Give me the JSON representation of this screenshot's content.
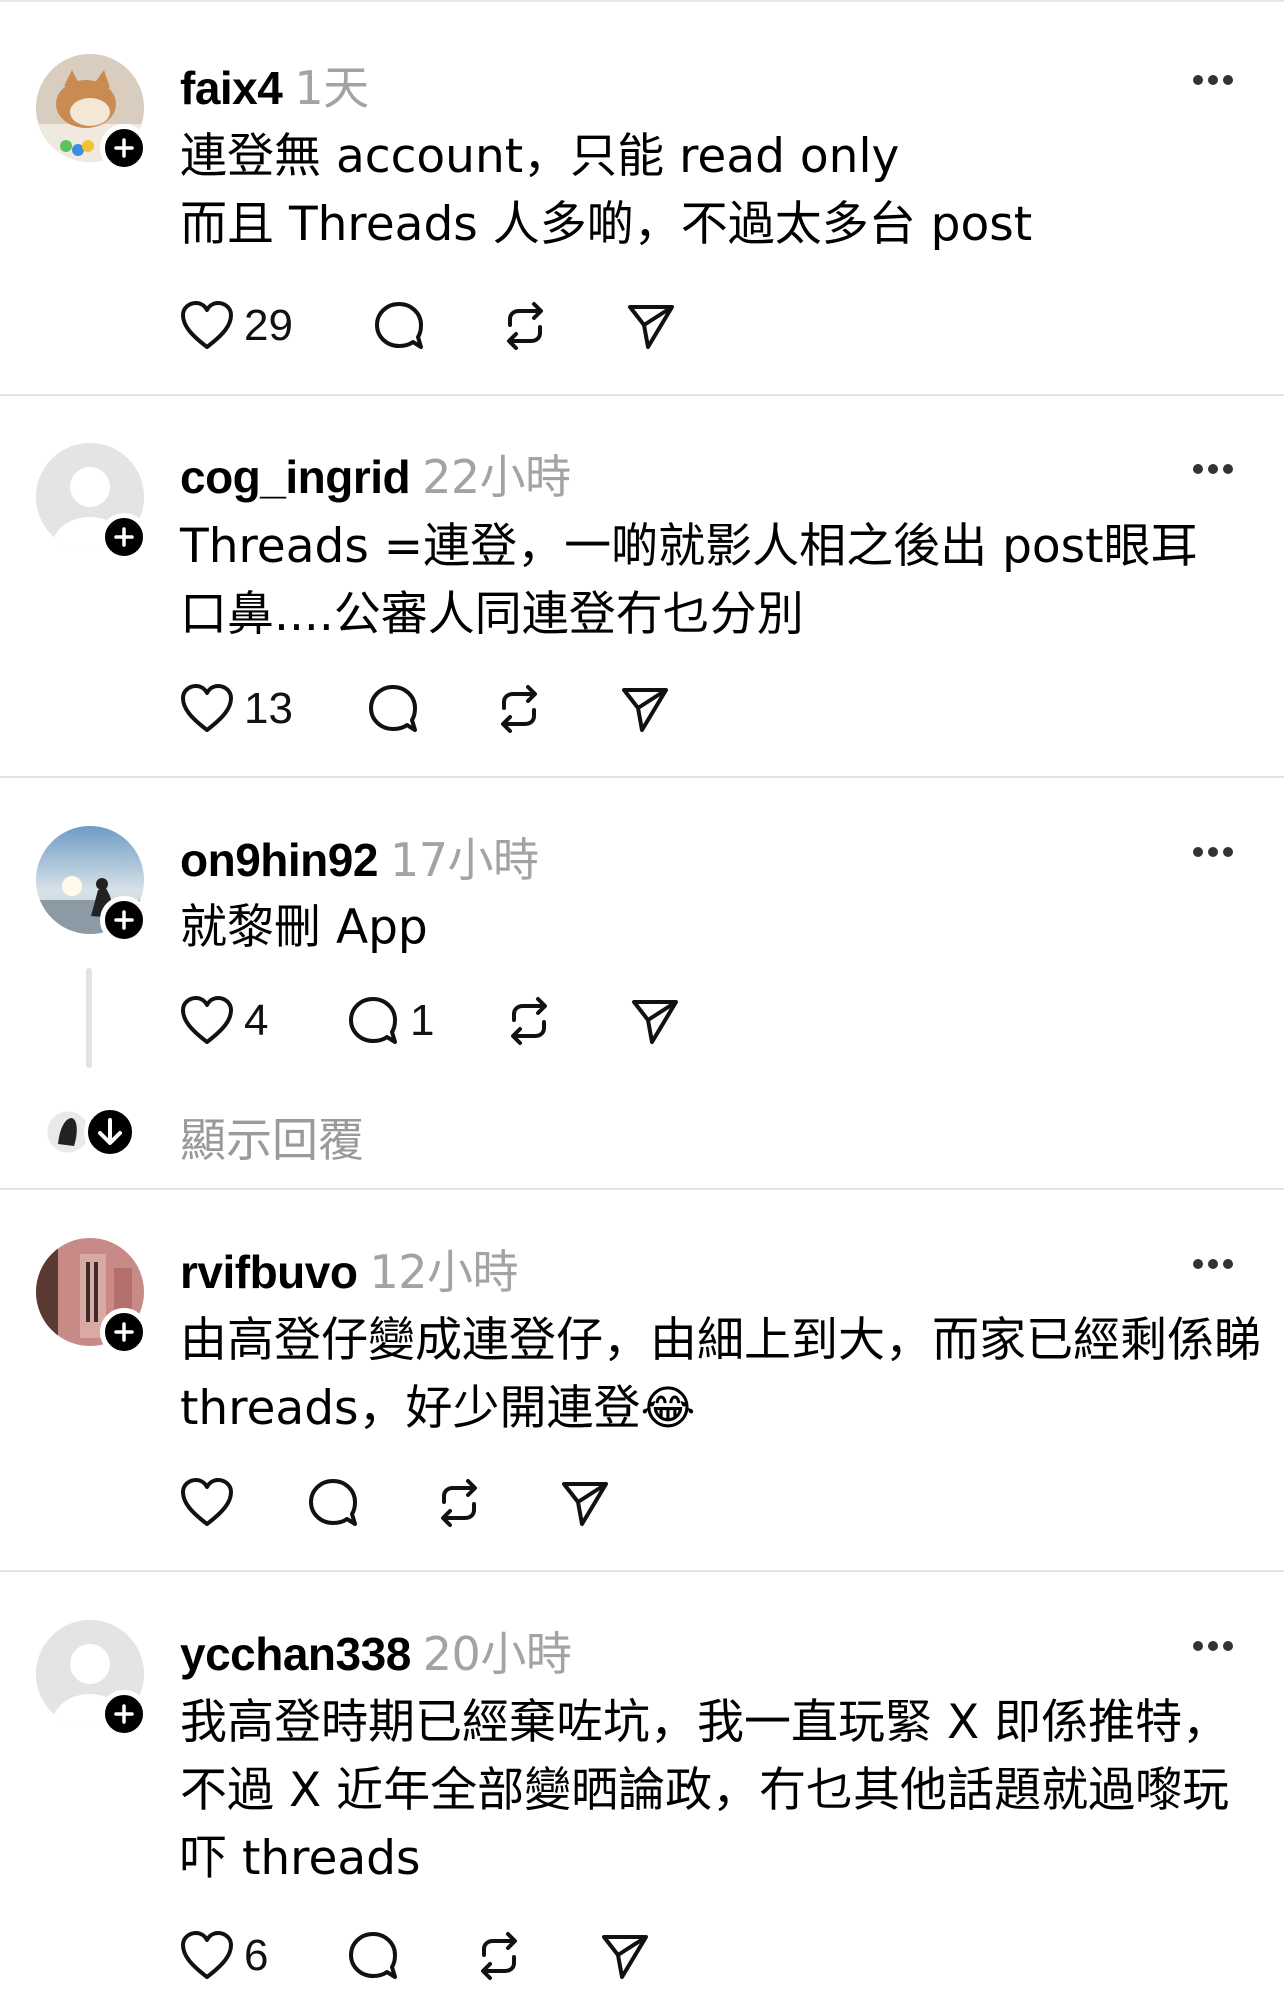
{
  "posts": [
    {
      "username": "faix4",
      "time": "1天",
      "text": "連登無 account，只能 read only\n而且 Threads 人多啲，不過太多台 post",
      "likes": "29",
      "replies": "",
      "avatar": "cat-photo"
    },
    {
      "username": "cog_ingrid",
      "time": "22小時",
      "text": "Threads =連登，一啲就影人相之後出 post眼耳口鼻....公審人同連登冇乜分別",
      "likes": "13",
      "replies": "",
      "avatar": "default-person"
    },
    {
      "username": "on9hin92",
      "time": "17小時",
      "text": "就黎刪 App",
      "likes": "4",
      "replies": "1",
      "avatar": "sunset-photo",
      "show_replies": "顯示回覆"
    },
    {
      "username": "rvifbuvo",
      "time": "12小時",
      "text": "由高登仔變成連登仔，由細上到大，而家已經剩係睇 threads，好少開連登😂",
      "likes": "",
      "replies": "",
      "avatar": "poster-photo"
    },
    {
      "username": "ycchan338",
      "time": "20小時",
      "text": "我高登時期已經棄咗坑，我一直玩緊 X 即係推特，不過 X 近年全部變晒論政，冇乜其他話題就過嚟玩吓 threads",
      "likes": "6",
      "replies": "",
      "avatar": "default-person"
    }
  ],
  "icons": {
    "like": "heart-icon",
    "reply": "comment-icon",
    "repost": "repost-icon",
    "share": "send-icon",
    "more": "more-icon",
    "follow": "plus-icon"
  },
  "colors": {
    "text": "#000000",
    "muted": "#a3a3a3",
    "divider": "#e3e3e3"
  }
}
